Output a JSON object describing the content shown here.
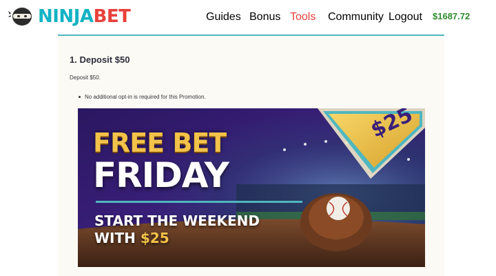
{
  "brand": {
    "part1": "NINJA",
    "part2": "BET"
  },
  "nav": [
    {
      "label": "Guides",
      "active": false
    },
    {
      "label": "Bonus",
      "active": false
    },
    {
      "label": "Tools",
      "active": true
    },
    {
      "label": "Community",
      "active": false
    },
    {
      "label": "Logout",
      "active": false
    }
  ],
  "balance": "$1687.72",
  "content": {
    "step_title": "1. Deposit $50",
    "step_description": "Deposit $50.",
    "bullets": [
      "No additional opt-in is required for this Promotion."
    ]
  },
  "banner": {
    "line1": "FREE BET",
    "line2": "FRIDAY",
    "line3": "START THE WEEKEND",
    "line4_prefix": "WITH ",
    "line4_amount": "$25",
    "badge_amount": "$25"
  },
  "colors": {
    "brand_teal": "#12b3c4",
    "brand_red": "#e8413b",
    "balance_green": "#2e8b2e",
    "banner_gold": "#f2c24a",
    "banner_purple": "#3a1f7a"
  },
  "icons": {
    "logo": "ninja-mask-icon",
    "badge": "diamond-badge-icon",
    "glove": "baseball-glove-icon"
  }
}
